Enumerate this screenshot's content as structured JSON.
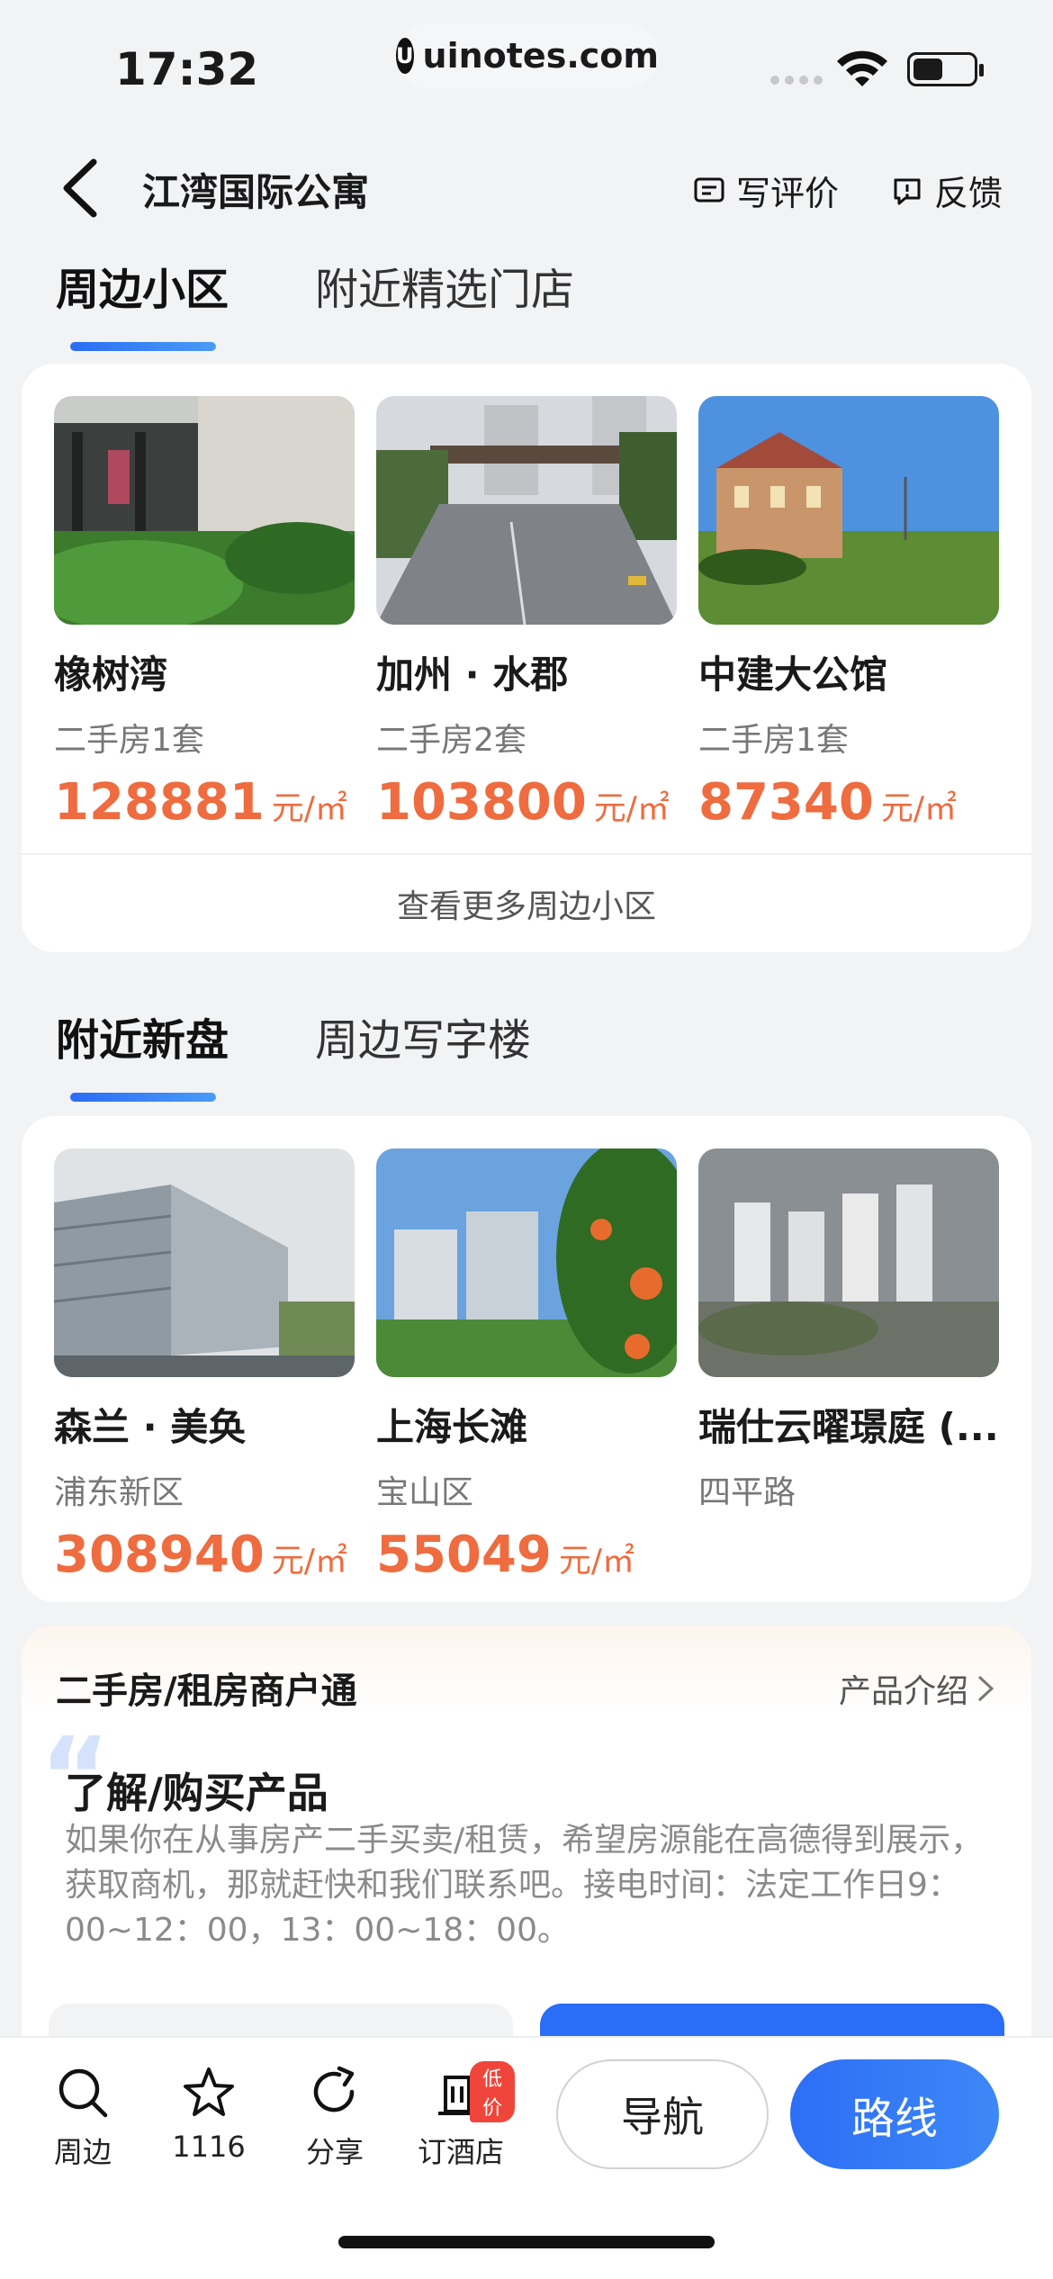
{
  "status": {
    "time": "17:32",
    "url": "uinotes.com"
  },
  "header": {
    "title": "江湾国际公寓",
    "review_label": "写评价",
    "feedback_label": "反馈"
  },
  "section1": {
    "tabs": [
      {
        "label": "周边小区"
      },
      {
        "label": "附近精选门店"
      }
    ],
    "items": [
      {
        "name": "橡树湾",
        "sub": "二手房1套",
        "price": "128881",
        "unit": "元/㎡"
      },
      {
        "name": "加州 · 水郡",
        "sub": "二手房2套",
        "price": "103800",
        "unit": "元/㎡"
      },
      {
        "name": "中建大公馆",
        "sub": "二手房1套",
        "price": "87340",
        "unit": "元/㎡"
      }
    ],
    "more_label": "查看更多周边小区"
  },
  "section2": {
    "tabs": [
      {
        "label": "附近新盘"
      },
      {
        "label": "周边写字楼"
      }
    ],
    "items": [
      {
        "name": "森兰 · 美奂",
        "sub": "浦东新区",
        "price": "308940",
        "unit": "元/㎡"
      },
      {
        "name": "上海长滩",
        "sub": "宝山区",
        "price": "55049",
        "unit": "元/㎡"
      },
      {
        "name": "瑞仕云曜璟庭 (...",
        "sub": "四平路"
      }
    ]
  },
  "merchant": {
    "title": "二手房/租房商户通",
    "intro_label": "产品介绍",
    "learn_title": "了解/购买产品",
    "learn_desc": "如果你在从事房产二手买卖/租赁，希望房源能在高德得到展示，获取商机，那就赶快和我们联系吧。接电时间：法定工作日9：00~12：00，13：00~18：00。"
  },
  "bottom_bar": {
    "around_label": "周边",
    "fav_count": "1116",
    "share_label": "分享",
    "hotel_label": "订酒店",
    "hotel_badge": "低价",
    "nav_label": "导航",
    "route_label": "路线"
  },
  "colors": {
    "accent": "#2a6df6",
    "price": "#ee6c3f",
    "badge": "#f0453a"
  }
}
